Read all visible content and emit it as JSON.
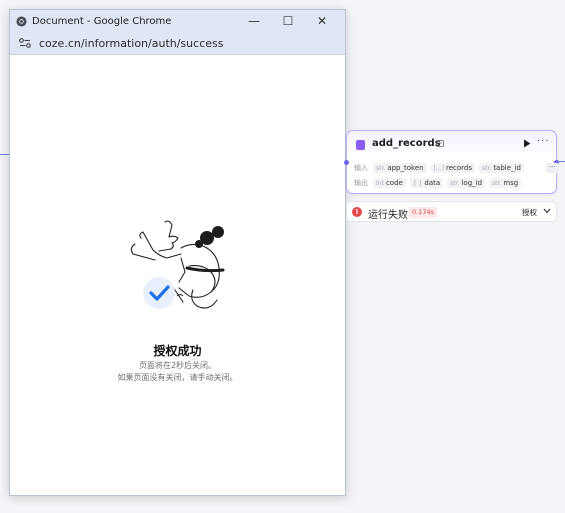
{
  "window": {
    "title": "Document - Google Chrome",
    "url": "coze.cn/information/auth/success",
    "controls": {
      "minimize": "—",
      "maximize": "☐",
      "close": "✕"
    }
  },
  "page": {
    "success_title": "授权成功",
    "message_line1": "页面将在2秒后关闭。",
    "message_line2": "如果页面没有关闭，请手动关闭。"
  },
  "node": {
    "title": "add_records",
    "input_label": "输入",
    "output_label": "输出",
    "inputs": [
      {
        "type": "str.",
        "name": "app_token"
      },
      {
        "type": "[...]",
        "name": "records"
      },
      {
        "type": "str.",
        "name": "table_id"
      }
    ],
    "inputs_more": "···",
    "outputs": [
      {
        "type": "Int",
        "name": "code"
      },
      {
        "type": "{ }",
        "name": "data"
      },
      {
        "type": "str.",
        "name": "log_id"
      },
      {
        "type": "str.",
        "name": "msg"
      }
    ],
    "more": "···"
  },
  "status": {
    "text": "运行失败",
    "time": "0.174s",
    "action": "授权",
    "error_symbol": "!"
  },
  "colors": {
    "accent": "#6f63e8",
    "error": "#e5484d",
    "chrome_frame": "#dfe7f5",
    "success_check": "#1e6fe8"
  }
}
